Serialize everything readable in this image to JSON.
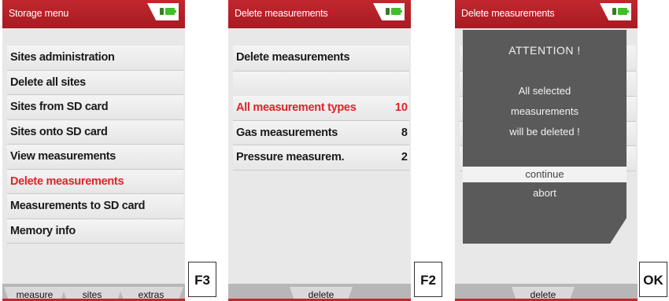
{
  "screen1": {
    "title": "Storage menu",
    "items": [
      {
        "label": "Sites administration",
        "selected": false
      },
      {
        "label": "Delete all sites",
        "selected": false
      },
      {
        "label": "Sites from SD card",
        "selected": false
      },
      {
        "label": "Sites onto SD card",
        "selected": false
      },
      {
        "label": "View measurements",
        "selected": false
      },
      {
        "label": "Delete measurements",
        "selected": true
      },
      {
        "label": "Measurements to SD card",
        "selected": false
      },
      {
        "label": "Memory info",
        "selected": false
      }
    ],
    "softkeys": [
      "measure",
      "sites",
      "extras"
    ],
    "fkey": "F3"
  },
  "screen2": {
    "title": "Delete measurements",
    "header": "Delete measurements",
    "items": [
      {
        "label": "All measurement types",
        "count": "10",
        "selected": true
      },
      {
        "label": "Gas measurements",
        "count": "8",
        "selected": false
      },
      {
        "label": "Pressure measurem.",
        "count": "2",
        "selected": false
      }
    ],
    "softkey": "delete",
    "fkey": "F2"
  },
  "screen3": {
    "title": "Delete measurements",
    "dialog": {
      "heading": "ATTENTION !",
      "line1": "All selected",
      "line2": "measurements",
      "line3": "will be deleted !",
      "continue": "continue",
      "abort": "abort"
    },
    "softkey": "delete",
    "fkey": "OK"
  },
  "colors": {
    "header_red": "#c1272d",
    "selection_red": "#e0232a",
    "dialog_gray": "#5a5a5a"
  }
}
